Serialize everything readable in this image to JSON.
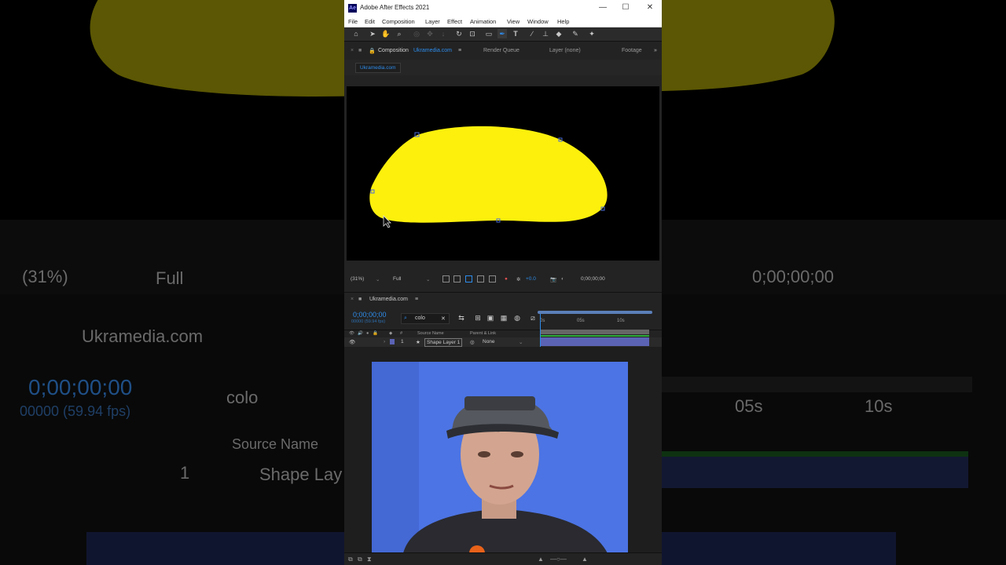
{
  "app": {
    "title": "Adobe After Effects 2021",
    "logo_text": "Ae",
    "window_controls": [
      "—",
      "☐",
      "✕"
    ]
  },
  "menu": [
    "File",
    "Edit",
    "Composition",
    "Layer",
    "Effect",
    "Animation",
    "View",
    "Window",
    "Help"
  ],
  "tools": [
    "home-icon",
    "selection-tool-icon",
    "hand-tool-icon",
    "zoom-tool-icon",
    "orbit-camera-icon",
    "pan-camera-icon",
    "dolly-camera-icon",
    "rotation-tool-icon",
    "anchor-point-tool-icon",
    "rectangle-tool-icon",
    "pen-tool-icon",
    "type-tool-icon",
    "brush-tool-icon",
    "clone-stamp-tool-icon",
    "eraser-tool-icon",
    "roto-brush-tool-icon",
    "puppet-pin-tool-icon"
  ],
  "panels": {
    "composition_label": "Composition",
    "composition_name": "Ukramedia.com",
    "render_queue": "Render Queue",
    "layer": "Layer (none)",
    "footage": "Footage",
    "comp_tab": "Ukramedia.com"
  },
  "viewer_bar": {
    "zoom": "(31%)",
    "resolution": "Full",
    "exposure": "+0.0",
    "timecode": "0;00;00;00"
  },
  "timeline": {
    "comp_name": "Ukramedia.com",
    "timecode": "0;00;00;00",
    "fps": "00000 (59.94 fps)",
    "search_value": "colo",
    "ruler_labels": [
      "0s",
      "05s",
      "10s"
    ],
    "columns": {
      "source_name": "Source Name",
      "parent_link": "Parent & Link"
    },
    "layer": {
      "index": "1",
      "name": "Shape Layer 1",
      "parent": "None"
    }
  },
  "colors": {
    "accent_blue": "#2d8ceb",
    "shape_fill": "#fcf00c",
    "layer_label": "#5b63b5",
    "webcam_bg": "#4a70e0"
  },
  "background": {
    "zoom": "(31%)",
    "resolution": "Full",
    "timecode": "0;00;00;00",
    "comp_name": "Ukramedia.com",
    "tl_timecode": "0;00;00;00",
    "fps": "00000 (59.94 fps)",
    "search": "colo",
    "source_name": "Source Name",
    "layer_index": "1",
    "layer_name": "Shape Lay",
    "ruler_05": "05s",
    "ruler_10": "10s"
  }
}
